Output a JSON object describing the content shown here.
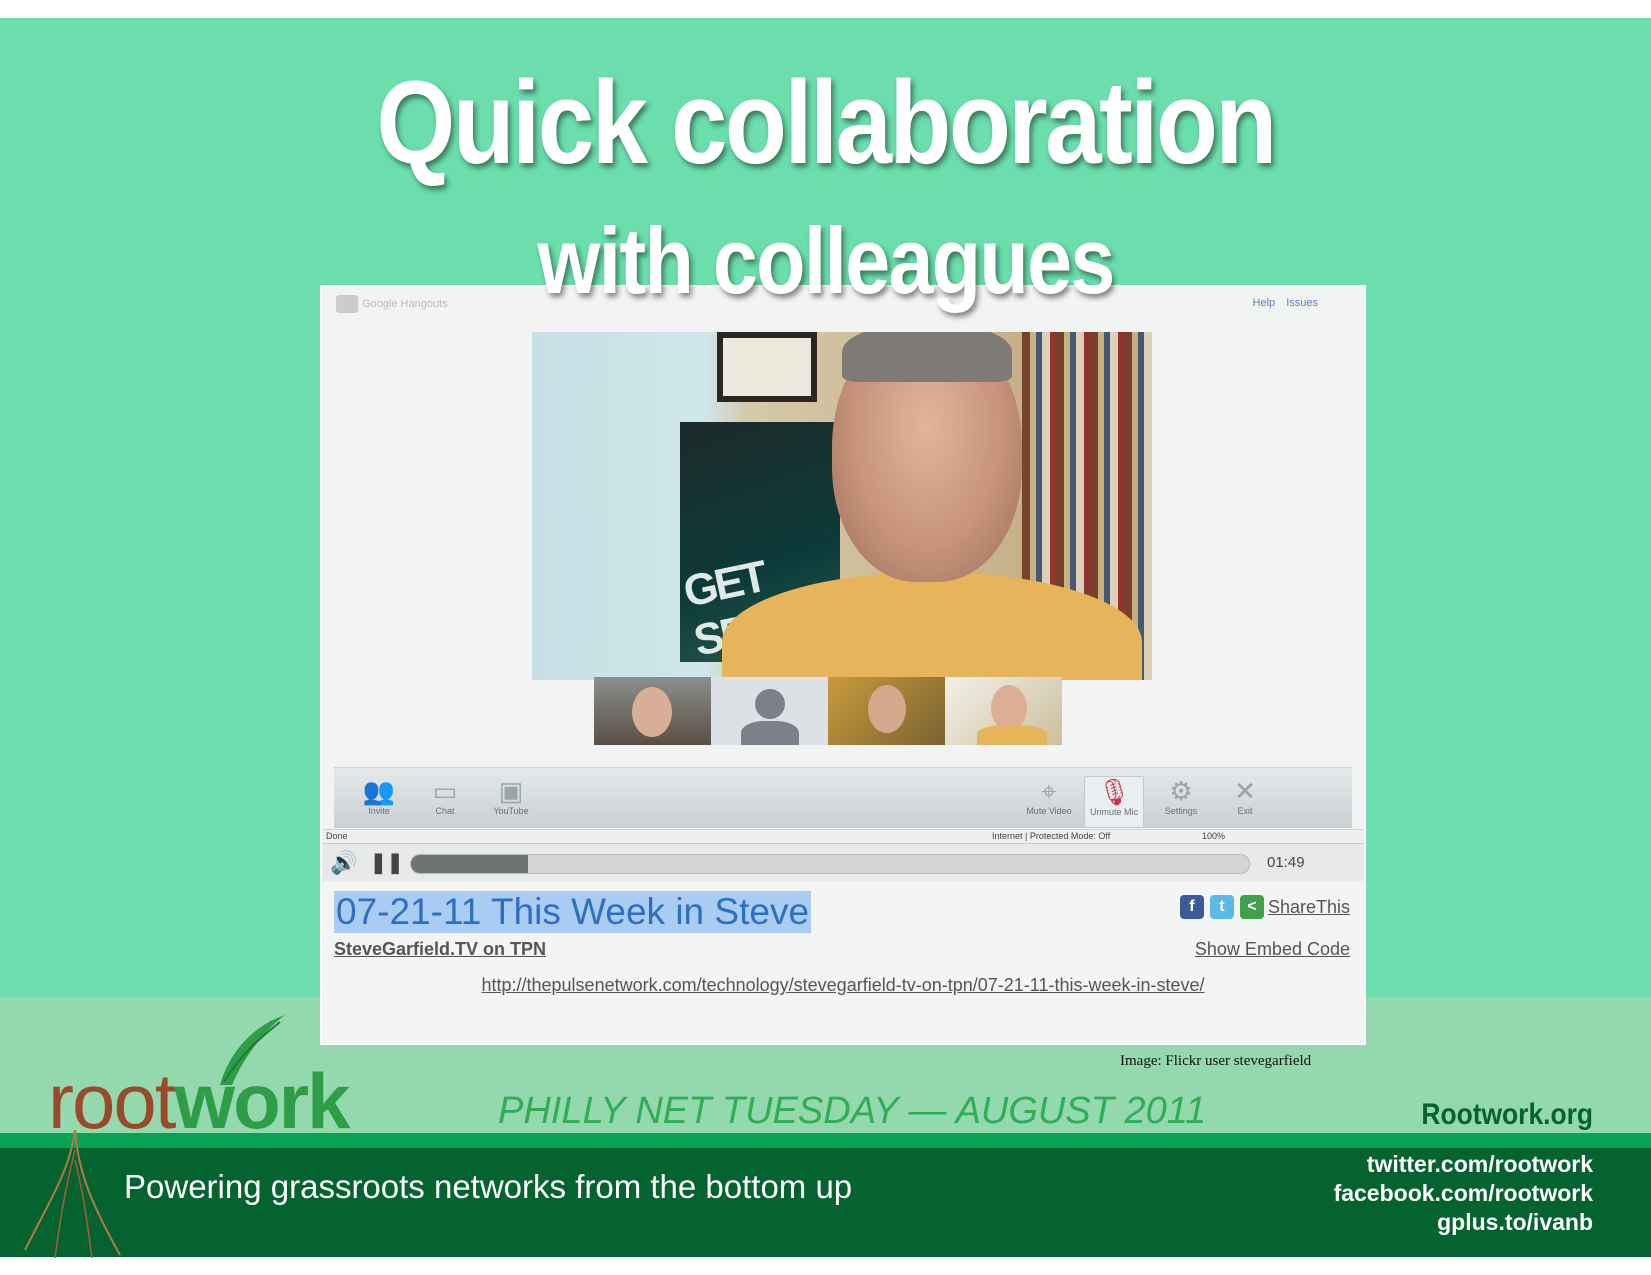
{
  "slide": {
    "title_line1": "Quick collaboration",
    "title_line2": "with colleagues"
  },
  "hangouts": {
    "logo_text": "Google Hangouts",
    "help_link": "Help",
    "issues_link": "Issues",
    "toolbar": [
      {
        "label": "Invite",
        "icon": "people-icon"
      },
      {
        "label": "Chat",
        "icon": "chat-icon"
      },
      {
        "label": "YouTube",
        "icon": "youtube-icon"
      },
      {
        "label": "Mute Video",
        "icon": "camera-icon"
      },
      {
        "label": "Unmute Mic",
        "icon": "mic-muted-icon"
      },
      {
        "label": "Settings",
        "icon": "gear-icon"
      },
      {
        "label": "Exit",
        "icon": "close-icon"
      }
    ],
    "status_left": "Done",
    "status_zone": "Internet | Protected Mode: Off",
    "status_zoom": "100%"
  },
  "player": {
    "progress_fraction": 0.14,
    "time": "01:49"
  },
  "video_info": {
    "title": "07-21-11 This Week in Steve",
    "subtitle": "SteveGarfield.TV on TPN",
    "share_label": "ShareThis",
    "embed_label": "Show Embed Code",
    "url": "http://thepulsenetwork.com/technology/stevegarfield-tv-on-tpn/07-21-11-this-week-in-steve/"
  },
  "credit": "Image: Flickr user stevegarfield",
  "footer": {
    "logo_root": "root",
    "logo_work": "work",
    "event": "PHILLY NET TUESDAY — AUGUST 2011",
    "site": "Rootwork.org",
    "tagline": "Powering grassroots networks from the bottom up",
    "links": [
      "twitter.com/rootwork",
      "facebook.com/rootwork",
      "gplus.to/ivanb"
    ]
  },
  "colors": {
    "slide_bg": "#6bdeac",
    "band_light": "#93d9ad",
    "band_dark": "#05632f",
    "accent_green": "#2fae57"
  }
}
